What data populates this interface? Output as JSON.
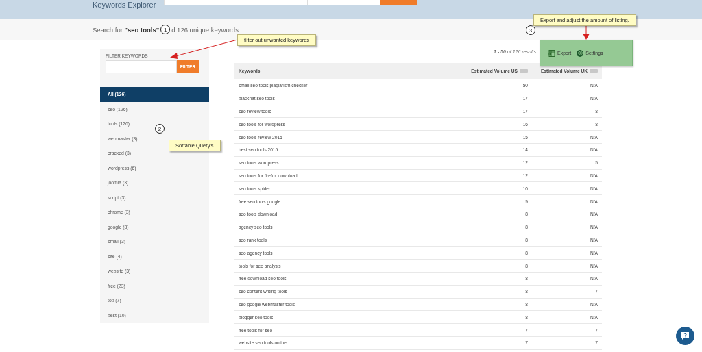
{
  "header": {
    "title": "Keywords Explorer"
  },
  "summary": {
    "prefix": "Search for **\"seo tools\"**",
    "suffix": "d 126 unique keywords"
  },
  "filter": {
    "label": "FILTER KEYWORDS",
    "button": "FILTER"
  },
  "sidebar": {
    "items": [
      {
        "label": "All (126)",
        "selected": true
      },
      {
        "label": "seo (126)",
        "selected": false
      },
      {
        "label": "tools (126)",
        "selected": false
      },
      {
        "label": "webmaster (3)",
        "selected": false
      },
      {
        "label": "cracked (3)",
        "selected": false
      },
      {
        "label": "wordpress (6)",
        "selected": false
      },
      {
        "label": "joomla (3)",
        "selected": false
      },
      {
        "label": "script (3)",
        "selected": false
      },
      {
        "label": "chrome (3)",
        "selected": false
      },
      {
        "label": "google (8)",
        "selected": false
      },
      {
        "label": "small (3)",
        "selected": false
      },
      {
        "label": "site (4)",
        "selected": false
      },
      {
        "label": "website (3)",
        "selected": false
      },
      {
        "label": "free (23)",
        "selected": false
      },
      {
        "label": "top (7)",
        "selected": false
      },
      {
        "label": "best (10)",
        "selected": false
      }
    ]
  },
  "results": {
    "range": "1 - 50",
    "rest": "of 126 results"
  },
  "toolbar": {
    "export": "Export",
    "settings": "Settings"
  },
  "table": {
    "columns": [
      "Keywords",
      "Estimated Volume US",
      "Estimated Volume UK"
    ],
    "rows": [
      [
        "small seo tools plagiarism checker",
        "50",
        "N/A"
      ],
      [
        "blackhat seo tools",
        "17",
        "N/A"
      ],
      [
        "seo review tools",
        "17",
        "8"
      ],
      [
        "seo tools for wordpress",
        "16",
        "8"
      ],
      [
        "seo tools review 2015",
        "15",
        "N/A"
      ],
      [
        "best seo tools 2015",
        "14",
        "N/A"
      ],
      [
        "seo tools wordpress",
        "12",
        "5"
      ],
      [
        "seo tools for firefox download",
        "12",
        "N/A"
      ],
      [
        "seo tools spider",
        "10",
        "N/A"
      ],
      [
        "free seo tools google",
        "9",
        "N/A"
      ],
      [
        "seo tools download",
        "8",
        "N/A"
      ],
      [
        "agency seo tools",
        "8",
        "N/A"
      ],
      [
        "seo rank tools",
        "8",
        "N/A"
      ],
      [
        "seo agency tools",
        "8",
        "N/A"
      ],
      [
        "tools for seo analysis",
        "8",
        "N/A"
      ],
      [
        "free download seo tools",
        "8",
        "N/A"
      ],
      [
        "seo content writing tools",
        "8",
        "7"
      ],
      [
        "seo google webmaster tools",
        "8",
        "N/A"
      ],
      [
        "blogger seo tools",
        "8",
        "N/A"
      ],
      [
        "free tools for seo",
        "7",
        "7"
      ],
      [
        "website seo tools online",
        "7",
        "7"
      ]
    ]
  },
  "annotations": {
    "notes": [
      "filter out unwanted keywords",
      "Sortable Query's",
      "Export and adjust the amount of listing."
    ],
    "markers": [
      "1",
      "2",
      "3"
    ]
  }
}
